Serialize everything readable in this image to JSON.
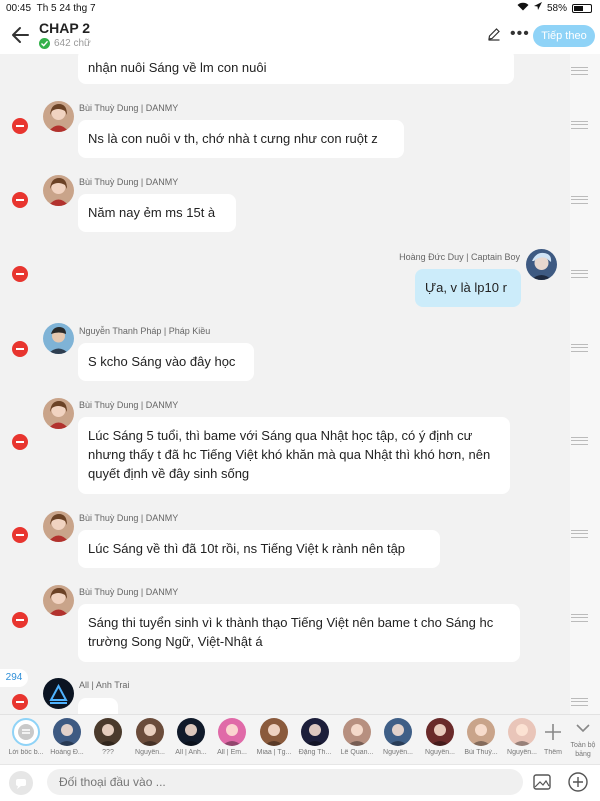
{
  "status": {
    "time": "00:45",
    "date": "Th 5 24 thg 7",
    "battery": "58%",
    "battery_level": 0.58
  },
  "header": {
    "title": "CHAP 2",
    "word_count": "642 chữ",
    "next_label": "Tiếp theo"
  },
  "messages": [
    {
      "author": "",
      "text": "nhận nuôi Sáng về lm con nuôi",
      "mine": false
    },
    {
      "author": "Bùi Thuỳ Dung | DANMY",
      "text": "Ns là con nuôi v th, chớ nhà t cưng như con ruột z",
      "mine": false
    },
    {
      "author": "Bùi Thuỳ Dung | DANMY",
      "text": "Năm nay ẻm ms 15t à",
      "mine": false
    },
    {
      "author": "Hoàng Đức Duy | Captain Boy",
      "text": "Ựa, v là lp10 r",
      "mine": true
    },
    {
      "author": "Nguyễn Thanh Pháp | Pháp Kiều",
      "text": "S kcho Sáng vào đây học",
      "mine": false
    },
    {
      "author": "Bùi Thuỳ Dung | DANMY",
      "text": "Lúc Sáng 5 tuổi, thì bame với Sáng qua Nhật học tập, có ý định cư nhưng thấy t đã hc Tiếng Việt khó khăn mà qua Nhật thì khó hơn, nên quyết định về đây sinh sống",
      "mine": false
    },
    {
      "author": "Bùi Thuỳ Dung | DANMY",
      "text": "Lúc Sáng về thì đã 10t rồi, ns Tiếng Việt k rành nên tập",
      "mine": false
    },
    {
      "author": "Bùi Thuỳ Dung | DANMY",
      "text": "Sáng thi tuyển sinh vì k thành thạo Tiếng Việt nên bame t cho Sáng hc trường Song Ngữ, Việt-Nhật á",
      "mine": false
    },
    {
      "author": "All | Anh Trai",
      "text": "",
      "mine": false
    }
  ],
  "scroll_badge": "294",
  "characters": [
    {
      "label": "Lời bốc b...",
      "color": "#dfe6ec"
    },
    {
      "label": "Hoàng Đ...",
      "color": "#3e5a82"
    },
    {
      "label": "???",
      "color": "#4a3a2c"
    },
    {
      "label": "Nguyễn...",
      "color": "#6b4c3b"
    },
    {
      "label": "All | Anh...",
      "color": "#101a2a"
    },
    {
      "label": "All | Em...",
      "color": "#e06aa8"
    },
    {
      "label": "Miaa | Tg...",
      "color": "#8a5a3c"
    },
    {
      "label": "Đặng Th...",
      "color": "#1c1e3a"
    },
    {
      "label": "Lê Quan...",
      "color": "#b79080"
    },
    {
      "label": "Nguyễn...",
      "color": "#3f5f87"
    },
    {
      "label": "Nguyễn...",
      "color": "#6a2a2a"
    },
    {
      "label": "Bùi Thuỳ...",
      "color": "#c9a48a"
    },
    {
      "label": "Nguyễn...",
      "color": "#e9c5b9"
    }
  ],
  "actions": {
    "add_label": "Thêm",
    "fullscreen_label": "Toàn bộ bảng"
  },
  "input": {
    "placeholder": "Đối thoại đầu vào ..."
  },
  "icons": [
    "back-arrow-icon",
    "check-icon",
    "pencil-icon",
    "more-icon",
    "delete-icon",
    "drag-handle-icon",
    "plus-icon",
    "chevron-down-icon",
    "chat-bubble-icon",
    "image-icon"
  ],
  "colors": {
    "accent": "#8fd3f7",
    "delete": "#e8352f",
    "my_bubble": "#ccecfa",
    "verified": "#33b14a"
  }
}
